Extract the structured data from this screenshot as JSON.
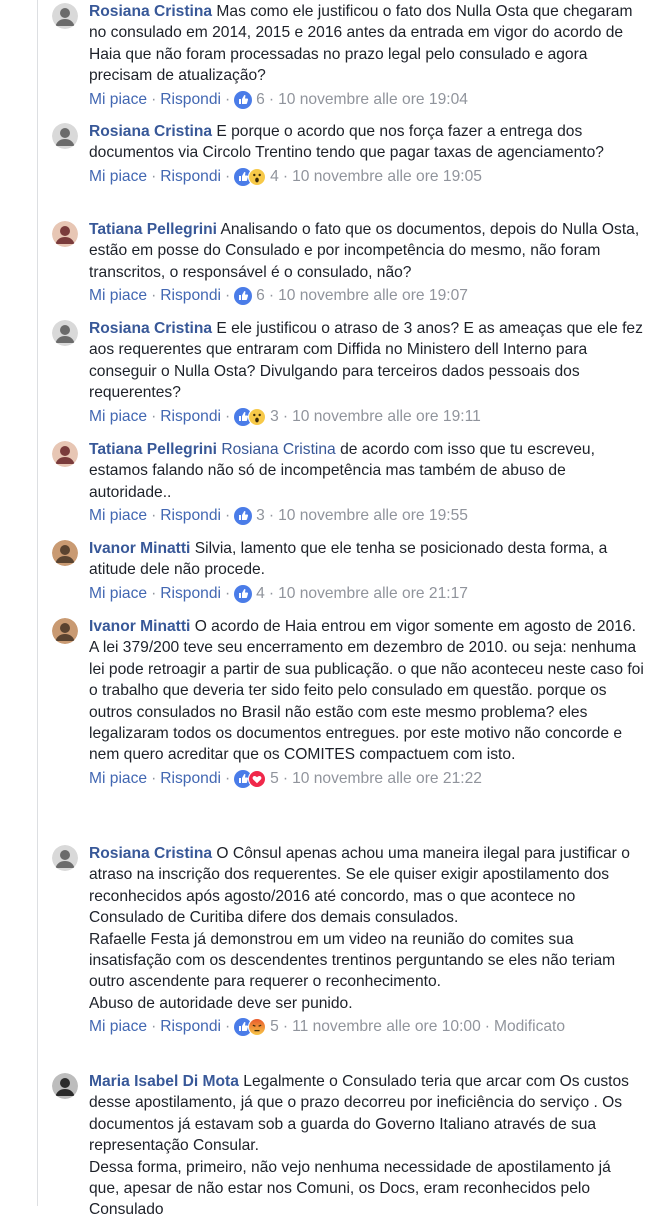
{
  "actions": {
    "like": "Mi piace",
    "reply": "Rispondi",
    "edited": "Modificato"
  },
  "colors": {
    "author": "#385898",
    "link": "#4267b2",
    "meta": "#90949c",
    "like_blue": "#4a7ce8"
  },
  "comments": [
    {
      "author": "Rosiana Cristina",
      "text": "Mas como ele justificou o fato dos Nulla Osta que chegaram no consulado em 2014, 2015 e 2016 antes da entrada em vigor do acordo de Haia que não foram processadas no prazo legal pelo consulado e agora precisam de atualização?",
      "reactions": [
        "like"
      ],
      "count": "6",
      "time": "10 novembre alle ore 19:04"
    },
    {
      "author": "Rosiana Cristina",
      "text": "E porque o acordo que nos força fazer a entrega dos documentos via Circolo Trentino tendo que pagar taxas de agenciamento?",
      "reactions": [
        "like",
        "wow"
      ],
      "count": "4",
      "time": "10 novembre alle ore 19:05"
    },
    {
      "author": "Tatiana Pellegrini",
      "text": "Analisando o fato que os documentos, depois do Nulla Osta, estão em posse do Consulado e por incompetência do mesmo, não foram transcritos, o responsável é o consulado, não?",
      "reactions": [
        "like"
      ],
      "count": "6",
      "time": "10 novembre alle ore 19:07"
    },
    {
      "author": "Rosiana Cristina",
      "text": "E ele justificou o atraso de 3 anos? E as ameaças que ele fez aos requerentes que entraram com Diffida no Ministero dell Interno para conseguir o Nulla Osta? Divulgando para terceiros dados pessoais dos requerentes?",
      "reactions": [
        "like",
        "wow"
      ],
      "count": "3",
      "time": "10 novembre alle ore 19:11"
    },
    {
      "author": "Tatiana Pellegrini",
      "mention": "Rosiana Cristina",
      "text": "de acordo com isso que tu escreveu, estamos falando não só de incompetência mas também de abuso de autoridade..",
      "reactions": [
        "like"
      ],
      "count": "3",
      "time": "10 novembre alle ore 19:55"
    },
    {
      "author": "Ivanor Minatti",
      "text": "Silvia, lamento que ele tenha se posicionado desta forma, a atitude dele não procede.",
      "reactions": [
        "like"
      ],
      "count": "4",
      "time": "10 novembre alle ore 21:17"
    },
    {
      "author": "Ivanor Minatti",
      "text": "O acordo de Haia entrou em vigor somente em agosto de 2016. A lei 379/200 teve seu encerramento em dezembro de 2010. ou seja: nenhuma lei pode retroagir a partir de sua publicação. o que não aconteceu neste caso foi o trabalho que deveria ter sido feito pelo consulado em questão. porque os outros consulados no Brasil não estão com este mesmo problema? eles legalizaram todos os documentos entregues. por este motivo não concorde e nem quero acreditar que os COMITES compactuem com isto.",
      "reactions": [
        "like",
        "love"
      ],
      "count": "5",
      "time": "10 novembre alle ore 21:22"
    },
    {
      "author": "Rosiana Cristina",
      "text": "O Cônsul apenas achou uma maneira ilegal para justificar o atraso na inscrição dos requerentes. Se ele quiser exigir apostilamento dos reconhecidos após agosto/2016 até concordo, mas o que acontece no Consulado de Curitiba difere dos demais consulados.\nRafaelle Festa já demonstrou em um video na reunião do comites sua insatisfação com os descendentes trentinos perguntando se eles não teriam outro ascendente para requerer o reconhecimento.\nAbuso de autoridade deve ser punido.",
      "reactions": [
        "like",
        "angry"
      ],
      "count": "5",
      "time": "11 novembre alle ore 10:00",
      "edited": true
    },
    {
      "author": "Maria Isabel Di Mota",
      "text": "Legalmente o Consulado teria que arcar com Os custos desse apostilamento, já que o prazo decorreu por ineficiência do serviço . Os documentos já estavam sob a guarda do Governo Italiano através de sua representação Consular.\nDessa forma, primeiro, não vejo nenhuma necessidade de apostilamento já que, apesar de não estar nos Comuni, os Docs, eram reconhecidos pelo Consulado"
    }
  ]
}
